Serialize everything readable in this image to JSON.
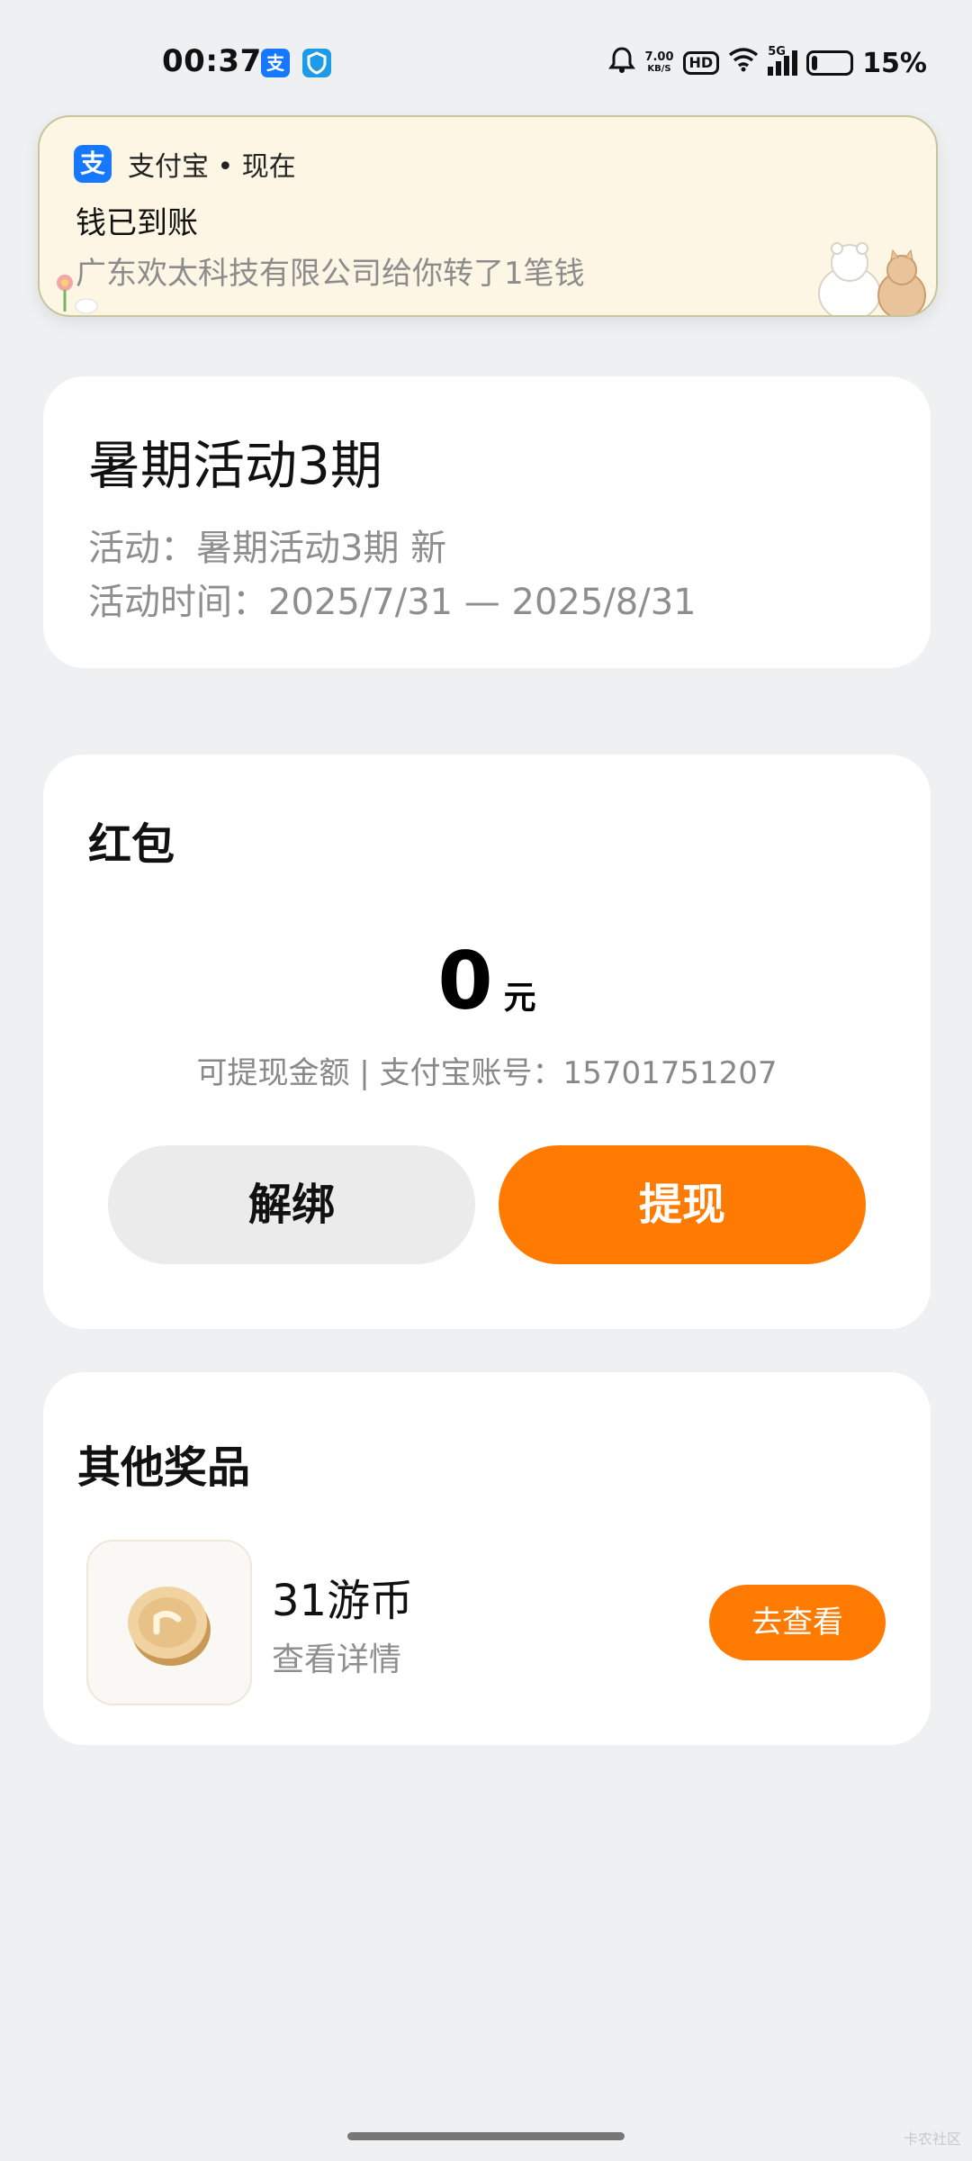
{
  "status_bar": {
    "time": "00:37",
    "net_speed_value": "7.00",
    "net_speed_unit": "KB/S",
    "hd": "HD",
    "network": "5G",
    "battery": "15%",
    "battery_level": 0.15,
    "app_icons": [
      "alipay-icon",
      "shield-app-icon"
    ]
  },
  "notification": {
    "app": "支付宝 • 现在",
    "title": "钱已到账",
    "body": "广东欢太科技有限公司给你转了1笔钱"
  },
  "activity": {
    "title": "暑期活动3期",
    "line1": "活动：暑期活动3期 新",
    "line2": "活动时间：2025/7/31 — 2025/8/31"
  },
  "red_packet": {
    "title": "红包",
    "amount": "0",
    "unit": "元",
    "desc": "可提现金额 | 支付宝账号：15701751207",
    "unbind_label": "解绑",
    "withdraw_label": "提现"
  },
  "prizes": {
    "title": "其他奖品",
    "item": {
      "name": "31游币",
      "sub": "查看详情",
      "button": "去查看"
    }
  },
  "watermark": "卡农社区",
  "colors": {
    "accent": "#ff7a00",
    "alipay_blue": "#1677ff",
    "background": "#eff0f2"
  }
}
